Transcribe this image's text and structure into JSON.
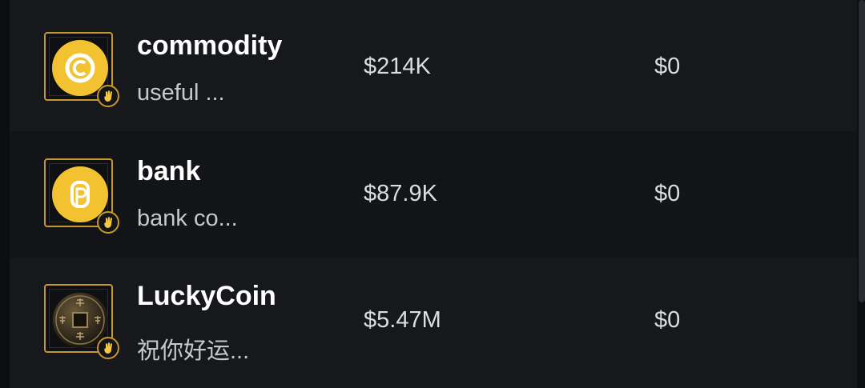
{
  "tokens": [
    {
      "name": "commodity",
      "description": "useful ...",
      "market_cap": "$214K",
      "volume": "$0",
      "icon": "commodity-coin-icon",
      "badge_icon": "hand-wave-icon"
    },
    {
      "name": "bank",
      "description": "bank co...",
      "market_cap": "$87.9K",
      "volume": "$0",
      "icon": "bank-coin-icon",
      "badge_icon": "hand-wave-icon"
    },
    {
      "name": "LuckyCoin",
      "description": "祝你好运...",
      "market_cap": "$5.47M",
      "volume": "$0",
      "icon": "ancient-chinese-coin-icon",
      "badge_icon": "hand-wave-icon"
    }
  ],
  "colors": {
    "background": "#0d0e11",
    "row": "#17181c",
    "row_alt": "#131418",
    "accent_gold": "#c8962f",
    "coin_yellow": "#f2c230"
  }
}
